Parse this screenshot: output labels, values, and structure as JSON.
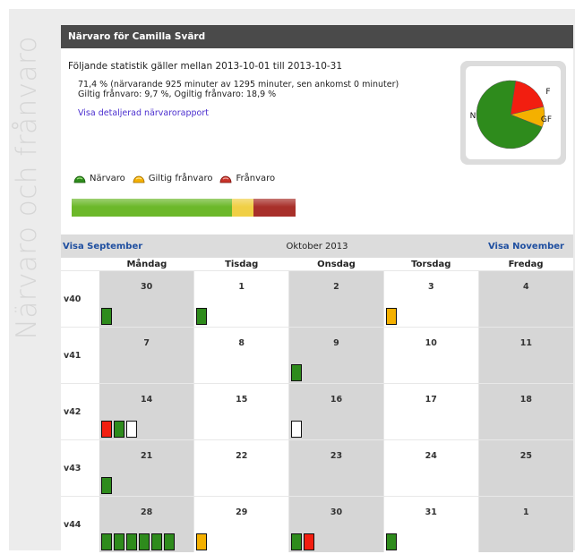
{
  "side_title": "Närvaro och frånvaro",
  "header": {
    "title": "Närvaro för Camilla Svärd"
  },
  "stats": {
    "period": "Följande statistik gäller mellan 2013-10-01 till 2013-10-31",
    "line1": "71,4 % (närvarande 925 minuter av 1295 minuter, sen ankomst 0 minuter)",
    "line2": "Giltig frånvaro: 9,7 %, Ogiltig frånvaro: 18,9 %",
    "report_link": "Visa detaljerad närvarorapport"
  },
  "pie": {
    "slices": [
      {
        "label": "N",
        "value": 71.4,
        "color": "#2e8b1c"
      },
      {
        "label": "F",
        "value": 18.9,
        "color": "#f21e10"
      },
      {
        "label": "GF",
        "value": 9.7,
        "color": "#f4b000"
      }
    ]
  },
  "legend": [
    {
      "label": "Närvaro",
      "icon": "green-half-circle-icon",
      "color": "#2e8b1c"
    },
    {
      "label": "Giltig frånvaro",
      "icon": "yellow-half-circle-icon",
      "color": "#f4b000"
    },
    {
      "label": "Frånvaro",
      "icon": "red-half-circle-icon",
      "color": "#b02020"
    }
  ],
  "summary_bar": {
    "segments": [
      {
        "name": "närvaro",
        "fraction": 0.714,
        "color": "#6cb82a"
      },
      {
        "name": "giltig-franvaro",
        "fraction": 0.097,
        "color": "#f0cf45"
      },
      {
        "name": "franvaro",
        "fraction": 0.189,
        "color": "#a8302a"
      }
    ]
  },
  "calendar": {
    "prev_label": "Visa September",
    "month_title": "Oktober 2013",
    "next_label": "Visa November",
    "weekdays": [
      "Måndag",
      "Tisdag",
      "Onsdag",
      "Torsdag",
      "Fredag"
    ],
    "weeks": [
      {
        "label": "v40",
        "days": [
          {
            "num": "30",
            "marks": [
              "green"
            ]
          },
          {
            "num": "1",
            "marks": [
              "green"
            ]
          },
          {
            "num": "2",
            "marks": []
          },
          {
            "num": "3",
            "marks": [
              "orange"
            ]
          },
          {
            "num": "4",
            "marks": []
          }
        ]
      },
      {
        "label": "v41",
        "days": [
          {
            "num": "7",
            "marks": []
          },
          {
            "num": "8",
            "marks": []
          },
          {
            "num": "9",
            "marks": [
              "green"
            ]
          },
          {
            "num": "10",
            "marks": []
          },
          {
            "num": "11",
            "marks": []
          }
        ]
      },
      {
        "label": "v42",
        "days": [
          {
            "num": "14",
            "marks": [
              "red",
              "green",
              "white"
            ]
          },
          {
            "num": "15",
            "marks": []
          },
          {
            "num": "16",
            "marks": [
              "white"
            ]
          },
          {
            "num": "17",
            "marks": []
          },
          {
            "num": "18",
            "marks": []
          }
        ]
      },
      {
        "label": "v43",
        "days": [
          {
            "num": "21",
            "marks": [
              "green"
            ]
          },
          {
            "num": "22",
            "marks": []
          },
          {
            "num": "23",
            "marks": []
          },
          {
            "num": "24",
            "marks": []
          },
          {
            "num": "25",
            "marks": []
          }
        ]
      },
      {
        "label": "v44",
        "days": [
          {
            "num": "28",
            "marks": [
              "green",
              "green",
              "green",
              "green",
              "green",
              "green"
            ]
          },
          {
            "num": "29",
            "marks": [
              "orange"
            ]
          },
          {
            "num": "30",
            "marks": [
              "green",
              "red"
            ]
          },
          {
            "num": "31",
            "marks": [
              "green"
            ]
          },
          {
            "num": "1",
            "marks": []
          }
        ]
      }
    ]
  }
}
